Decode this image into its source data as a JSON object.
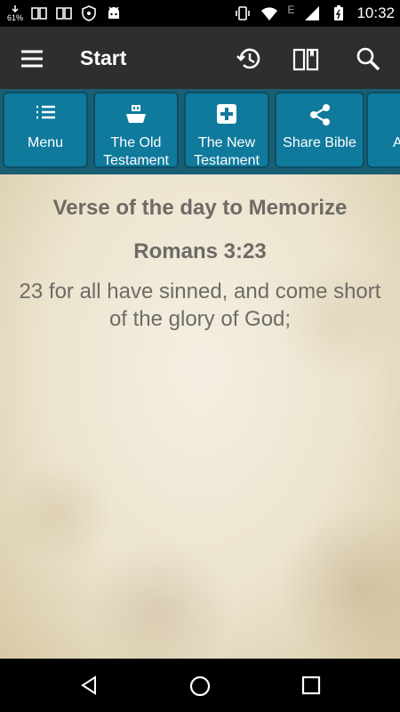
{
  "status_bar": {
    "battery_badge": "61%",
    "network_letter": "E",
    "time": "10:32",
    "icons": [
      "download-icon",
      "book-icon",
      "book-icon",
      "vpn-icon",
      "android-icon",
      "vibrate-icon",
      "wifi-icon",
      "signal-icon",
      "battery-icon"
    ]
  },
  "app_bar": {
    "title": "Start",
    "icons": [
      "menu-icon",
      "history-icon",
      "book-open-icon",
      "search-icon"
    ]
  },
  "tabs": [
    {
      "label": "Menu",
      "icon": "list-icon"
    },
    {
      "label": "The Old Testament",
      "icon": "ark-icon"
    },
    {
      "label": "The New Testament",
      "icon": "plus-box-icon"
    },
    {
      "label": "Share Bible",
      "icon": "share-icon"
    },
    {
      "label": "A",
      "icon": ""
    }
  ],
  "content": {
    "heading": "Verse of the day to Memorize",
    "reference": "Romans 3:23",
    "verse": "23 for all have sinned, and come short of the glory of God;"
  },
  "nav_bar": {
    "icons": [
      "back-icon",
      "home-icon",
      "recents-icon"
    ]
  },
  "colors": {
    "app_bar": "#2e2e2e",
    "tab_bg": "#0f7a9c",
    "tab_border": "#0b4f66",
    "content_text": "#6e6b66"
  }
}
